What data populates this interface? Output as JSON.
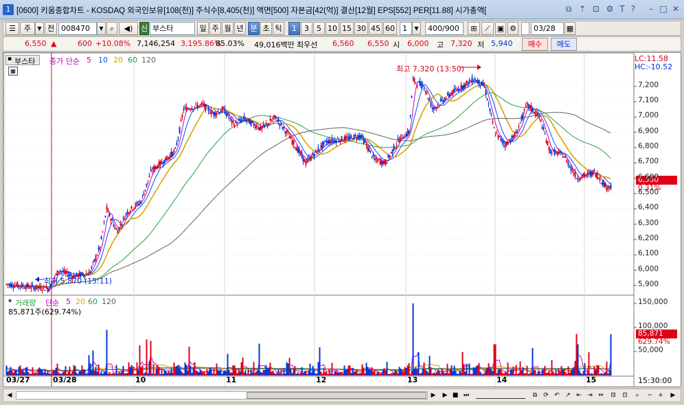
{
  "window": {
    "number": "1",
    "title": "[0600] 키움종합차트 - KOSDAQ 외국인보유[108(천)] 주식수[8,405(천)] 액면[500] 자본금[42(억)] 결산[12월] EPS[552] PER[11.88] 시가총액["
  },
  "toolbar": {
    "period_label": "주",
    "market_label": "전",
    "code": "008470",
    "badge": "신",
    "stock_name": "부스타",
    "period_tabs": [
      "일",
      "주",
      "월",
      "년",
      "분",
      "초",
      "틱"
    ],
    "selected_period": "분",
    "minute_buttons": [
      "1",
      "3",
      "5",
      "10",
      "15",
      "30",
      "45",
      "60"
    ],
    "selected_minute": "1",
    "count_value": "1",
    "range_value": "400/900",
    "date_value": "03/28"
  },
  "quote": {
    "price": "6,550",
    "arrow": "▲",
    "change": "600",
    "change_pct": "+10.08%",
    "volume": "7,146,254",
    "volume_ratio": "3,195.86%",
    "turnover_pct": "85.03%",
    "amount": "49,016백만",
    "best_label": "최우선",
    "best_ask": "6,560",
    "best_bid": "6,550",
    "open_label": "시",
    "open": "6,000",
    "high_label": "고",
    "high": "7,320",
    "low_label": "저",
    "low": "5,940",
    "buy_label": "매수",
    "sell_label": "매도"
  },
  "price_panel": {
    "name": "부스타",
    "legend_prefix": "종가 단순",
    "ma": [
      "5",
      "10",
      "20",
      "60",
      "120"
    ],
    "lc": "LC:11.58",
    "hc": "HC:-10.52",
    "high_annotation": "최고 7,320 (13:50)",
    "low_annotation": "최저 5,870 (15:11)",
    "current_price": "6,550",
    "current_pct": "0.31%",
    "yticks": [
      "7,200",
      "7,100",
      "7,000",
      "6,900",
      "6,800",
      "6,700",
      "6,600",
      "6,500",
      "6,400",
      "6,300",
      "6,200",
      "6,100",
      "6,000",
      "5,900"
    ]
  },
  "volume_panel": {
    "name": "거래량",
    "legend_prefix": "단순",
    "ma": [
      "5",
      "20",
      "60",
      "120"
    ],
    "last_volume": "85,871주(629.74%)",
    "current_volume": "85,871",
    "current_pct": "629.74%",
    "yticks": [
      "150,000",
      "100,000",
      "50,000"
    ]
  },
  "xaxis": {
    "labels": [
      "03/27",
      "03/28",
      "10",
      "11",
      "12",
      "13",
      "14",
      "15"
    ],
    "time_label": "15:30:00"
  },
  "colors": {
    "up": "#e0001a",
    "down": "#0038d8",
    "ma5": "#c000c0",
    "ma10": "#0050ff",
    "ma20": "#e0a000",
    "ma60": "#20a040",
    "ma120": "#606060"
  },
  "chart_data": {
    "type": "line",
    "x": [
      "03/27",
      "03/28 09:00",
      "10:00",
      "11:00",
      "12:00",
      "13:00",
      "13:50",
      "14:00",
      "15:00",
      "15:30"
    ],
    "series": [
      {
        "name": "종가",
        "values": [
          5910,
          5950,
          6700,
          7050,
          6850,
          6880,
          7320,
          6850,
          6680,
          6550
        ]
      }
    ],
    "ylim": [
      5850,
      7320
    ]
  }
}
